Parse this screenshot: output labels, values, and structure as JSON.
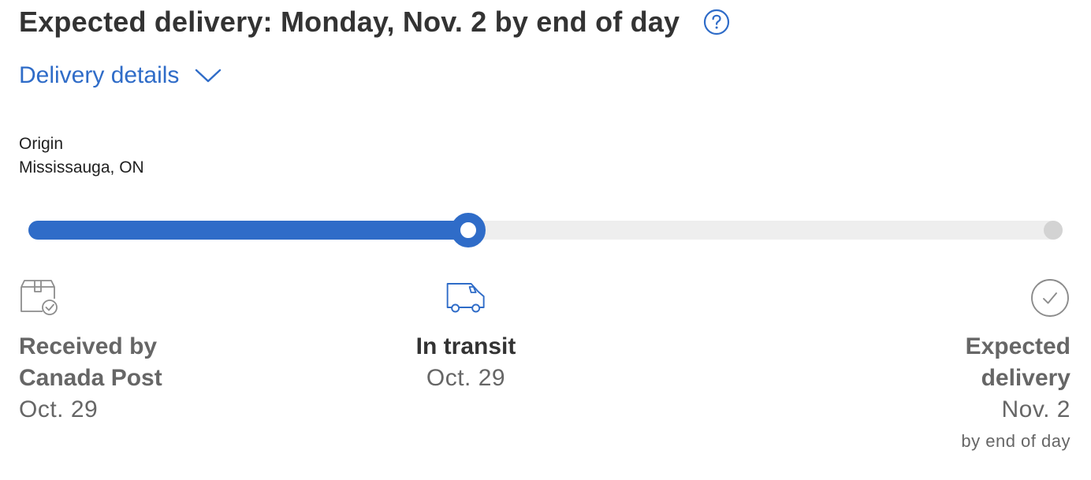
{
  "header": {
    "title": "Expected delivery: Monday, Nov. 2 by end of day",
    "help_icon": "question-circle-icon"
  },
  "details_toggle": {
    "label": "Delivery details",
    "icon": "chevron-down-icon"
  },
  "origin": {
    "label": "Origin",
    "location": "Mississauga, ON"
  },
  "progress": {
    "fraction": 0.425,
    "colors": {
      "filled": "#2f6cc8",
      "empty": "#eeeeee",
      "end_dot": "#d3d3d3"
    }
  },
  "steps": [
    {
      "icon": "box-check-icon",
      "title_line1": "Received by",
      "title_line2": "Canada Post",
      "date": "Oct. 29"
    },
    {
      "icon": "delivery-truck-icon",
      "title": "In transit",
      "date": "Oct. 29"
    },
    {
      "icon": "check-circle-icon",
      "title_line1": "Expected",
      "title_line2": "delivery",
      "date": "Nov. 2",
      "note": "by end of day"
    }
  ]
}
